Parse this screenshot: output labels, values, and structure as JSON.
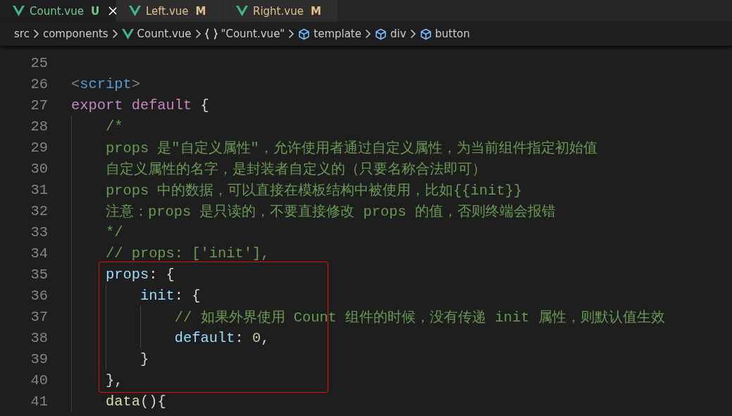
{
  "tabs": [
    {
      "label": "Count.vue",
      "status": "U",
      "kind": "untracked",
      "selected": true
    },
    {
      "label": "Left.vue",
      "status": "M",
      "kind": "modified",
      "selected": false
    },
    {
      "label": "Right.vue",
      "status": "M",
      "kind": "modified",
      "selected": false
    }
  ],
  "breadcrumb": [
    {
      "label": "src",
      "kind": "folder"
    },
    {
      "label": "components",
      "kind": "folder"
    },
    {
      "label": "Count.vue",
      "kind": "vue"
    },
    {
      "label": "\"Count.vue\"",
      "kind": "object"
    },
    {
      "label": "template",
      "kind": "element"
    },
    {
      "label": "div",
      "kind": "element"
    },
    {
      "label": "button",
      "kind": "element"
    }
  ],
  "editor": {
    "lines": [
      {
        "number": "25",
        "highlighted": false
      },
      {
        "number": "26",
        "highlighted": false,
        "tokens": [
          {
            "kind": "bracket",
            "text": "<"
          },
          {
            "kind": "tag",
            "text": "script"
          },
          {
            "kind": "bracket",
            "text": ">"
          }
        ]
      },
      {
        "number": "27",
        "highlighted": false,
        "tokens": [
          {
            "kind": "keyword",
            "text": "export default"
          },
          {
            "kind": "punct",
            "text": " {"
          }
        ]
      },
      {
        "number": "28",
        "highlighted": false,
        "tokens": [
          {
            "kind": "comment",
            "text": "    /*"
          }
        ]
      },
      {
        "number": "29",
        "highlighted": false,
        "tokens": [
          {
            "kind": "comment",
            "text": "    props 是\"自定义属性\"，允许使用者通过自定义属性，为当前组件指定初始值"
          }
        ]
      },
      {
        "number": "30",
        "highlighted": false,
        "tokens": [
          {
            "kind": "comment",
            "text": "    自定义属性的名字，是封装者自定义的（只要名称合法即可）"
          }
        ]
      },
      {
        "number": "31",
        "highlighted": false,
        "tokens": [
          {
            "kind": "comment",
            "text": "    props 中的数据，可以直接在模板结构中被使用，比如{{init}}"
          }
        ]
      },
      {
        "number": "32",
        "highlighted": false,
        "tokens": [
          {
            "kind": "comment",
            "text": "    注意：props 是只读的，不要直接修改 props 的值，否则终端会报错"
          }
        ]
      },
      {
        "number": "33",
        "highlighted": false,
        "tokens": [
          {
            "kind": "comment",
            "text": "    */"
          }
        ]
      },
      {
        "number": "34",
        "highlighted": false,
        "tokens": [
          {
            "kind": "comment",
            "text": "    // props: ['init'],"
          }
        ]
      },
      {
        "number": "35",
        "highlighted": true,
        "tokens": [
          {
            "kind": "property",
            "text": "    props"
          },
          {
            "kind": "punct",
            "text": ": {"
          }
        ]
      },
      {
        "number": "36",
        "highlighted": true,
        "tokens": [
          {
            "kind": "property",
            "text": "        init"
          },
          {
            "kind": "punct",
            "text": ": {"
          }
        ]
      },
      {
        "number": "37",
        "highlighted": true,
        "tokens": [
          {
            "kind": "comment",
            "text": "            // 如果外界使用 Count 组件的时候，没有传递 init 属性，则默认值生效"
          }
        ]
      },
      {
        "number": "38",
        "highlighted": true,
        "tokens": [
          {
            "kind": "property",
            "text": "            default"
          },
          {
            "kind": "punct",
            "text": ": "
          },
          {
            "kind": "number",
            "text": "0"
          },
          {
            "kind": "punct",
            "text": ","
          }
        ]
      },
      {
        "number": "39",
        "highlighted": true,
        "tokens": [
          {
            "kind": "punct",
            "text": "        }"
          }
        ]
      },
      {
        "number": "40",
        "highlighted": true,
        "tokens": [
          {
            "kind": "punct",
            "text": "    },"
          }
        ]
      },
      {
        "number": "41",
        "highlighted": false,
        "tokens": [
          {
            "kind": "function",
            "text": "    data"
          },
          {
            "kind": "punct",
            "text": "(){"
          }
        ]
      }
    ]
  }
}
